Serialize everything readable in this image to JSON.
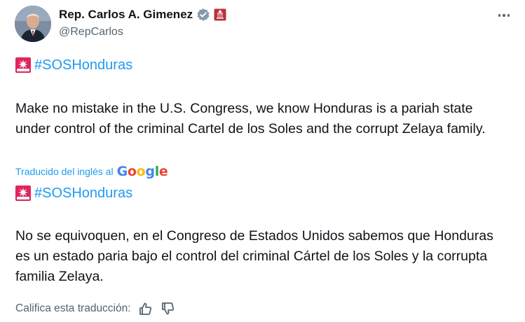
{
  "header": {
    "display_name": "Rep. Carlos A. Gimenez",
    "handle": "@RepCarlos"
  },
  "icons": {
    "avatar": "profile-photo",
    "verified": "verified-badge-icon",
    "affiliation": "capitol-affiliation-icon",
    "more": "more-options-icon",
    "siren": "rotating-light-emoji",
    "thumbs_up": "thumbs-up-icon",
    "thumbs_down": "thumbs-down-icon"
  },
  "colors": {
    "link": "#1d9bf0",
    "text": "#0f1419",
    "muted": "#536471",
    "verified": "#829aab",
    "siren": "#e0245e"
  },
  "tweet": {
    "hashtag_1": "#SOSHonduras",
    "text_en": "Make no mistake in the U.S. Congress, we know Honduras is a pariah state under control of the criminal Cartel de los Soles and the corrupt Zelaya family.",
    "translated_label": "Traducido del inglés al",
    "translation_provider": "Google",
    "hashtag_2": "#SOSHonduras",
    "text_es": "No se equivoquen, en el Congreso de Estados Unidos sabemos que Honduras es un estado paria bajo el control del criminal Cártel de los Soles y la corrupta familia Zelaya.",
    "rate_label": "Califica esta traducción:"
  }
}
